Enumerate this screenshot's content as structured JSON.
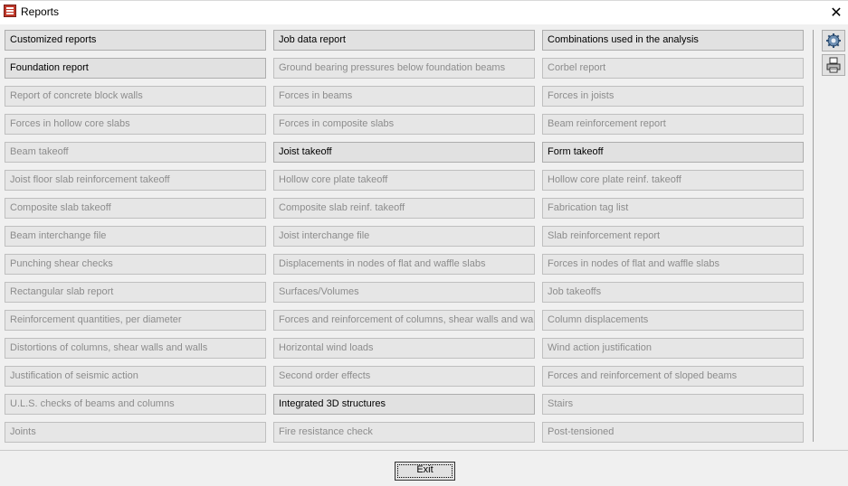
{
  "window": {
    "title": "Reports",
    "close_glyph": "✕",
    "icon": "app-logo-icon"
  },
  "columns": [
    [
      {
        "label": "Customized reports",
        "enabled": true
      },
      {
        "label": "Foundation report",
        "enabled": true
      },
      {
        "label": "Report of concrete block walls",
        "enabled": false
      },
      {
        "label": "Forces in hollow core slabs",
        "enabled": false
      },
      {
        "label": "Beam takeoff",
        "enabled": false
      },
      {
        "label": "Joist floor slab reinforcement takeoff",
        "enabled": false
      },
      {
        "label": "Composite slab takeoff",
        "enabled": false
      },
      {
        "label": "Beam interchange file",
        "enabled": false
      },
      {
        "label": "Punching shear checks",
        "enabled": false
      },
      {
        "label": "Rectangular slab report",
        "enabled": false
      },
      {
        "label": "Reinforcement quantities, per diameter",
        "enabled": false
      },
      {
        "label": "Distortions of columns, shear walls and walls",
        "enabled": false
      },
      {
        "label": "Justification of seismic action",
        "enabled": false
      },
      {
        "label": "U.L.S. checks of beams and columns",
        "enabled": false
      },
      {
        "label": "Joints",
        "enabled": false
      }
    ],
    [
      {
        "label": "Job data report",
        "enabled": true
      },
      {
        "label": "Ground bearing pressures below foundation beams",
        "enabled": false
      },
      {
        "label": "Forces in beams",
        "enabled": false
      },
      {
        "label": "Forces in composite slabs",
        "enabled": false
      },
      {
        "label": "Joist takeoff",
        "enabled": true
      },
      {
        "label": "Hollow core plate takeoff",
        "enabled": false
      },
      {
        "label": "Composite slab reinf. takeoff",
        "enabled": false
      },
      {
        "label": "Joist interchange file",
        "enabled": false
      },
      {
        "label": "Displacements in nodes of flat and waffle slabs",
        "enabled": false
      },
      {
        "label": "Surfaces/Volumes",
        "enabled": false
      },
      {
        "label": "Forces and reinforcement of columns, shear walls and walls",
        "enabled": false
      },
      {
        "label": "Horizontal wind loads",
        "enabled": false
      },
      {
        "label": "Second order effects",
        "enabled": false
      },
      {
        "label": "Integrated 3D structures",
        "enabled": true
      },
      {
        "label": "Fire resistance check",
        "enabled": false
      }
    ],
    [
      {
        "label": "Combinations used in the analysis",
        "enabled": true
      },
      {
        "label": "Corbel report",
        "enabled": false
      },
      {
        "label": "Forces in joists",
        "enabled": false
      },
      {
        "label": "Beam reinforcement report",
        "enabled": false
      },
      {
        "label": "Form takeoff",
        "enabled": true
      },
      {
        "label": "Hollow core plate reinf. takeoff",
        "enabled": false
      },
      {
        "label": "Fabrication tag list",
        "enabled": false
      },
      {
        "label": "Slab reinforcement report",
        "enabled": false
      },
      {
        "label": "Forces in nodes of flat and waffle slabs",
        "enabled": false
      },
      {
        "label": "Job takeoffs",
        "enabled": false
      },
      {
        "label": "Column displacements",
        "enabled": false
      },
      {
        "label": "Wind action justification",
        "enabled": false
      },
      {
        "label": "Forces and reinforcement of sloped beams",
        "enabled": false
      },
      {
        "label": "Stairs",
        "enabled": false
      },
      {
        "label": "Post-tensioned",
        "enabled": false
      }
    ]
  ],
  "toolbar": {
    "settings_icon": "gear-icon",
    "print_icon": "printer-icon"
  },
  "footer": {
    "exit_label": "Exit"
  }
}
